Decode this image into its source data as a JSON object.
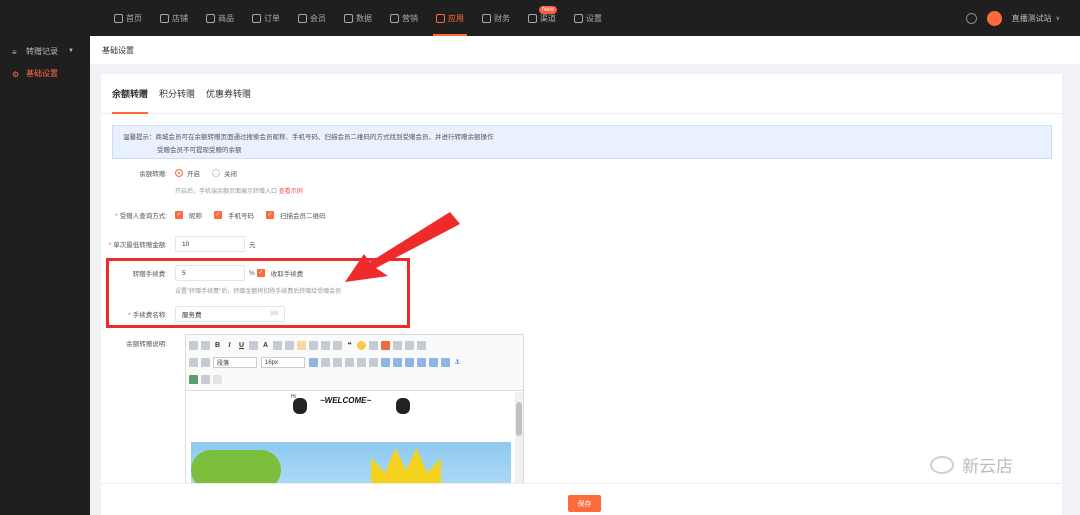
{
  "nav": {
    "items": [
      {
        "label": "首页",
        "icon": "home-icon"
      },
      {
        "label": "店铺",
        "icon": "store-icon"
      },
      {
        "label": "商品",
        "icon": "goods-icon"
      },
      {
        "label": "订单",
        "icon": "order-icon"
      },
      {
        "label": "会员",
        "icon": "member-icon"
      },
      {
        "label": "数据",
        "icon": "data-icon"
      },
      {
        "label": "营销",
        "icon": "tag-icon"
      },
      {
        "label": "应用",
        "icon": "app-icon"
      },
      {
        "label": "财务",
        "icon": "finance-icon"
      },
      {
        "label": "渠道",
        "icon": "channel-icon"
      },
      {
        "label": "设置",
        "icon": "gear-icon"
      }
    ],
    "new_badge": "New",
    "user_name": "直播测试站",
    "accent": "#ff6a3d"
  },
  "sidebar": {
    "items": [
      {
        "label": "转赠记录"
      },
      {
        "label": "基础设置"
      }
    ]
  },
  "breadcrumb": "基础设置",
  "tabs": [
    "余额转赠",
    "积分转赠",
    "优惠券转赠"
  ],
  "notice": {
    "line1": "温馨提示：商城会员可在余额转赠页面通过搜索会员昵称、手机号码、扫描会员二维码的方式找到受赠会员，并进行转赠余额操作",
    "line2": "受赠会员不可提现受赠的余额"
  },
  "form": {
    "balance_gift": {
      "label": "余额转赠:",
      "on": "开启",
      "off": "关闭",
      "hint": "开启后，手机端余额页面展示转赠入口",
      "hint_link": "查看示例"
    },
    "query": {
      "label": "受赠人查询方式:",
      "options": [
        "昵称",
        "手机号码",
        "扫描会员二维码"
      ]
    },
    "min_amount": {
      "label": "单次最低转赠金额:",
      "value": "10",
      "unit": "元"
    },
    "fee": {
      "label": "转赠手续费:",
      "value": "5",
      "unit": "%",
      "charge_label": "收取手续费",
      "hint": "设置\"转赠手续费\"后，转赠金额将扣除手续费后转赠给受赠会员"
    },
    "fee_name": {
      "label": "手续费名称:",
      "value": "服务费",
      "counter": "3/8"
    },
    "desc": {
      "label": "余额转赠说明:",
      "font_select": "段落",
      "size_select": "16px",
      "welcome_text": "~WELCOME~",
      "hi": "Hi"
    }
  },
  "save_label": "保存",
  "watermark": "新云店"
}
